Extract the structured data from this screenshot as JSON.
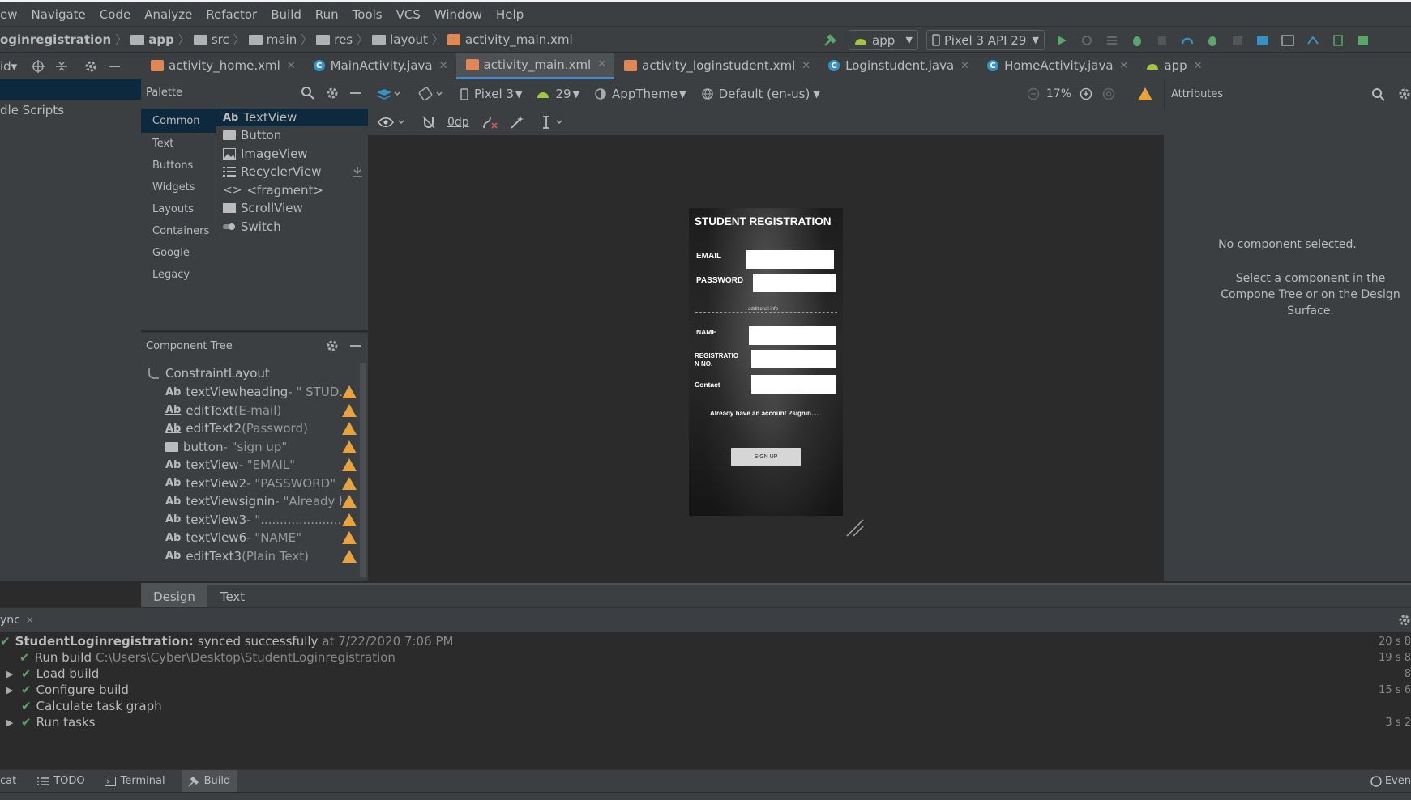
{
  "menu": [
    "ew",
    "Navigate",
    "Code",
    "Analyze",
    "Refactor",
    "Build",
    "Run",
    "Tools",
    "VCS",
    "Window",
    "Help"
  ],
  "breadcrumb": {
    "project": "oginregistration",
    "items": [
      "app",
      "src",
      "main",
      "res",
      "layout",
      "activity_main.xml"
    ]
  },
  "run_config": {
    "module": "app",
    "device": "Pixel 3 API 29"
  },
  "left_strip": {
    "dropdown": "id",
    "item": "dle Scripts"
  },
  "tabs": [
    {
      "label": "activity_home.xml",
      "kind": "xml"
    },
    {
      "label": "MainActivity.java",
      "kind": "class"
    },
    {
      "label": "activity_main.xml",
      "kind": "xml",
      "active": true
    },
    {
      "label": "activity_loginstudent.xml",
      "kind": "xml"
    },
    {
      "label": "Loginstudent.java",
      "kind": "class"
    },
    {
      "label": "HomeActivity.java",
      "kind": "class"
    },
    {
      "label": "app",
      "kind": "android"
    }
  ],
  "palette": {
    "title": "Palette",
    "categories": [
      "Common",
      "Text",
      "Buttons",
      "Widgets",
      "Layouts",
      "Containers",
      "Google",
      "Legacy"
    ],
    "widgets": [
      {
        "icon": "Ab",
        "label": "TextView"
      },
      {
        "icon": "button-icon",
        "label": "Button"
      },
      {
        "icon": "image-icon",
        "label": "ImageView"
      },
      {
        "icon": "list-icon",
        "label": "RecyclerView"
      },
      {
        "icon": "code-icon",
        "label": "<fragment>"
      },
      {
        "icon": "scroll-icon",
        "label": "ScrollView"
      },
      {
        "icon": "switch-icon",
        "label": "Switch"
      }
    ]
  },
  "design_toolbar": {
    "device": "Pixel 3",
    "api": "29",
    "theme": "AppTheme",
    "locale": "Default (en-us)",
    "zoom": "17%",
    "margin": "0dp"
  },
  "component_tree": {
    "title": "Component Tree",
    "root": "ConstraintLayout",
    "nodes": [
      {
        "icon": "Ab",
        "name": "textViewheading",
        "detail": "- \" STUD..."
      },
      {
        "icon": "Ab-edit",
        "name": "editText",
        "detail": "(E-mail)"
      },
      {
        "icon": "Ab-edit",
        "name": "editText2",
        "detail": "(Password)"
      },
      {
        "icon": "button-icon",
        "name": "button",
        "detail": "- \"sign up\""
      },
      {
        "icon": "Ab",
        "name": "textView",
        "detail": "- \"EMAIL\""
      },
      {
        "icon": "Ab",
        "name": "textView2",
        "detail": "- \"PASSWORD\""
      },
      {
        "icon": "Ab",
        "name": "textViewsignin",
        "detail": "- \"Already h..."
      },
      {
        "icon": "Ab",
        "name": "textView3",
        "detail": "- \"....................................."
      },
      {
        "icon": "Ab",
        "name": "textView6",
        "detail": "- \"NAME\""
      },
      {
        "icon": "Ab-edit",
        "name": "editText3",
        "detail": "(Plain Text)"
      }
    ]
  },
  "phone": {
    "heading": "STUDENT REGISTRATION",
    "email_label": "EMAIL",
    "password_label": "PASSWORD",
    "divider_text": "additional info",
    "name_label": "NAME",
    "reg_label": "REGISTRATIO N NO.",
    "contact_label": "Contact",
    "signin_text": "Already have an account ?signin....",
    "button": "SIGN UP"
  },
  "attributes": {
    "title": "Attributes",
    "empty_title": "No component selected.",
    "empty_hint": "Select a component in the Compone Tree or on the Design Surface."
  },
  "editor_modes": [
    "Design",
    "Text"
  ],
  "build": {
    "tab": "ync",
    "lines": [
      {
        "indent": 0,
        "tri": false,
        "project": "StudentLoginregistration:",
        "status": "synced successfully",
        "time": "at 7/22/2020 7:06 PM",
        "duration": "20 s 8"
      },
      {
        "indent": 1,
        "tri": false,
        "label": "Run build",
        "path": "C:\\Users\\Cyber\\Desktop\\StudentLoginregistration",
        "duration": "19 s 8"
      },
      {
        "indent": 2,
        "tri": true,
        "label": "Load build",
        "duration": "8"
      },
      {
        "indent": 2,
        "tri": true,
        "label": "Configure build",
        "duration": "15 s 6"
      },
      {
        "indent": 2,
        "tri": false,
        "label": "Calculate task graph",
        "duration": ""
      },
      {
        "indent": 2,
        "tri": true,
        "label": "Run tasks",
        "duration": "3 s 2"
      }
    ]
  },
  "bottom_tools": [
    "cat",
    "TODO",
    "Terminal",
    "Build"
  ],
  "bottom_right": "Even",
  "colors": {
    "accent": "#4a88c7",
    "warning": "#e8a33d",
    "success": "#59a869",
    "selection": "#0d293e"
  }
}
